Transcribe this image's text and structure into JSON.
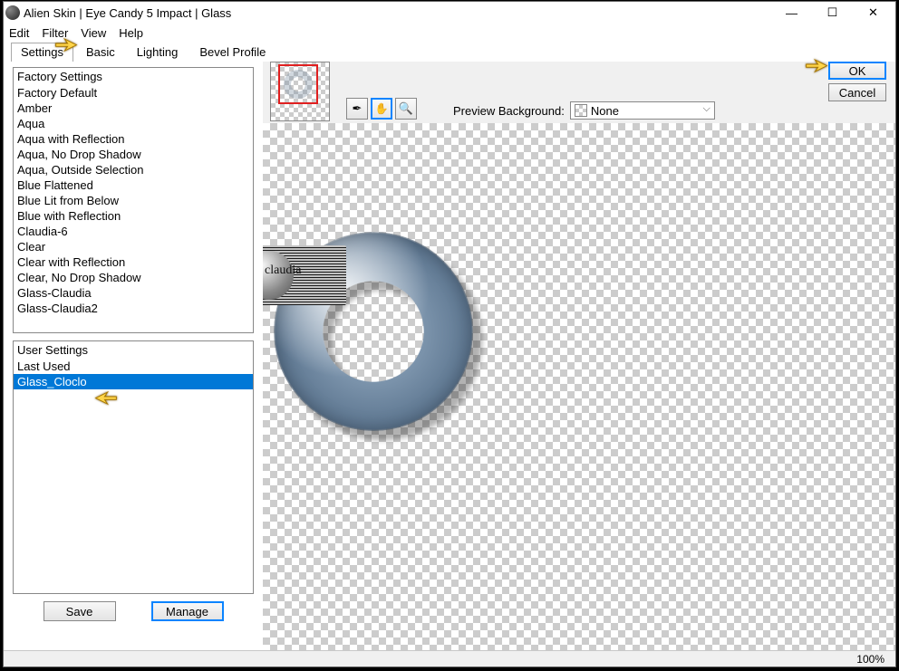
{
  "title": "Alien Skin | Eye Candy 5 Impact | Glass",
  "menu": {
    "edit": "Edit",
    "filter": "Filter",
    "view": "View",
    "help": "Help"
  },
  "tabs": {
    "settings": "Settings",
    "basic": "Basic",
    "lighting": "Lighting",
    "bevel": "Bevel Profile"
  },
  "factory": {
    "header": "Factory Settings",
    "items": [
      "Factory Default",
      "Amber",
      "Aqua",
      "Aqua with Reflection",
      "Aqua, No Drop Shadow",
      "Aqua, Outside Selection",
      "Blue Flattened",
      "Blue Lit from Below",
      "Blue with Reflection",
      "Claudia-6",
      "Clear",
      "Clear with Reflection",
      "Clear, No Drop Shadow",
      "Glass-Claudia",
      "Glass-Claudia2"
    ]
  },
  "user": {
    "header": "User Settings",
    "items": [
      "Last Used",
      "Glass_Cloclo"
    ],
    "selected_index": 1
  },
  "buttons": {
    "save": "Save",
    "manage": "Manage",
    "ok": "OK",
    "cancel": "Cancel"
  },
  "preview": {
    "bg_label": "Preview Background:",
    "bg_value": "None"
  },
  "watermark": "claudia",
  "status": {
    "zoom": "100%"
  },
  "icons": {
    "eyedropper": "⯐",
    "hand": "✋",
    "zoom": "🔍"
  }
}
